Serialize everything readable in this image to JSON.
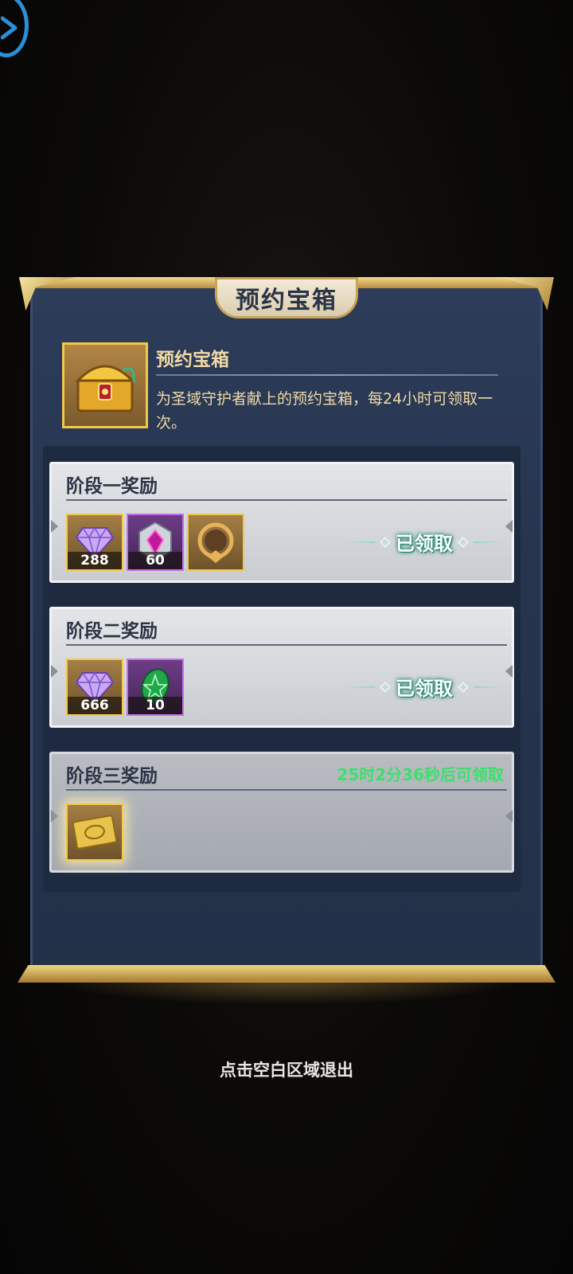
{
  "panel": {
    "title": "预约宝箱",
    "item_name": "预约宝箱",
    "item_desc": "为圣域守护者献上的预约宝箱，每24小时可领取一次。"
  },
  "stages": [
    {
      "title": "阶段一奖励",
      "status": "已领取",
      "items": [
        {
          "icon": "diamond-gem-icon",
          "count": "288"
        },
        {
          "icon": "purple-crystal-badge-icon",
          "count": "60"
        },
        {
          "icon": "golden-frame-ring-icon",
          "count": ""
        }
      ]
    },
    {
      "title": "阶段二奖励",
      "status": "已领取",
      "items": [
        {
          "icon": "diamond-gem-icon",
          "count": "666"
        },
        {
          "icon": "green-rune-stone-icon",
          "count": "10"
        }
      ]
    },
    {
      "title": "阶段三奖励",
      "countdown": "25时2分36秒后可领取",
      "items": [
        {
          "icon": "golden-ticket-card-icon",
          "count": ""
        }
      ]
    }
  ],
  "exit_hint": "点击空白区域退出",
  "colors": {
    "accent_gold": "#f2c84a",
    "countdown_green": "#3ce06a",
    "panel_bg": "#26344e"
  }
}
